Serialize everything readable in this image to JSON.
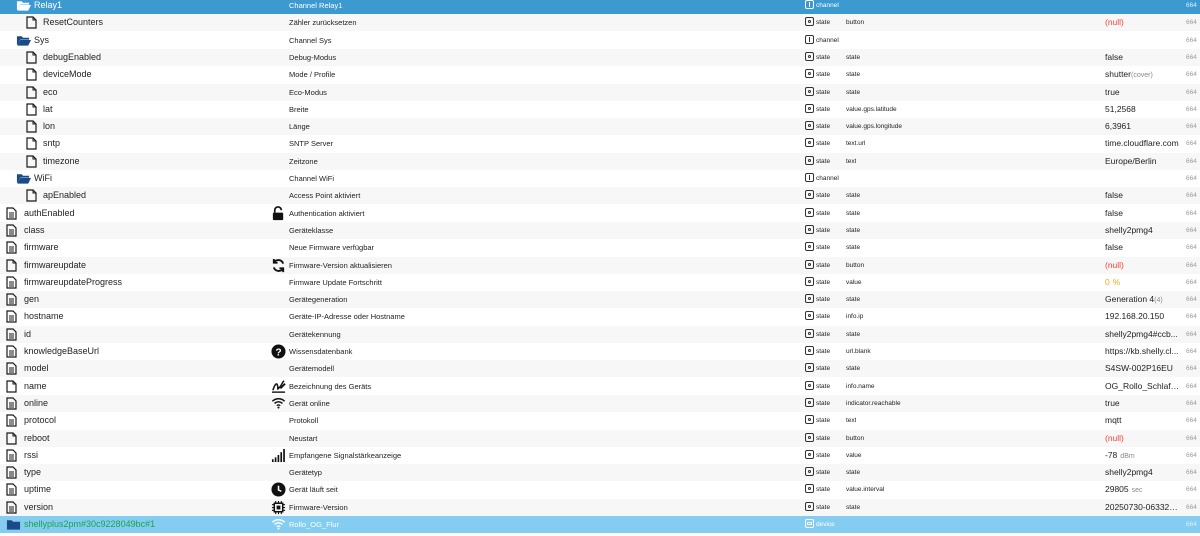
{
  "rows": [
    {
      "name": "Relay1",
      "desc": "Channel Relay1",
      "typeLabel": "channel",
      "role": "",
      "value": "",
      "num": "664",
      "icon": "folder-open",
      "indent": 1,
      "selected": true
    },
    {
      "name": "ResetCounters",
      "desc": "Zähler zurücksetzen",
      "typeLabel": "state",
      "role": "button",
      "value": "(null)",
      "num": "664",
      "icon": "file",
      "indent": 2
    },
    {
      "name": "Sys",
      "desc": "Channel Sys",
      "typeLabel": "channel",
      "role": "",
      "value": "",
      "num": "664",
      "icon": "folder-open",
      "indent": 1
    },
    {
      "name": "debugEnabled",
      "desc": "Debug-Modus",
      "typeLabel": "state",
      "role": "state",
      "value": "false",
      "num": "664",
      "icon": "file",
      "indent": 2
    },
    {
      "name": "deviceMode",
      "desc": "Mode / Profile",
      "typeLabel": "state",
      "role": "state",
      "value": "shutter",
      "valueExtra": "(cover)",
      "num": "664",
      "icon": "file",
      "indent": 2
    },
    {
      "name": "eco",
      "desc": "Eco-Modus",
      "typeLabel": "state",
      "role": "state",
      "value": "true",
      "num": "664",
      "icon": "file",
      "indent": 2
    },
    {
      "name": "lat",
      "desc": "Breite",
      "typeLabel": "state",
      "role": "value.gps.latitude",
      "value": "51,2568",
      "num": "664",
      "icon": "file",
      "indent": 2
    },
    {
      "name": "lon",
      "desc": "Länge",
      "typeLabel": "state",
      "role": "value.gps.longitude",
      "value": "6,3961",
      "num": "664",
      "icon": "file",
      "indent": 2
    },
    {
      "name": "sntp",
      "desc": "SNTP Server",
      "typeLabel": "state",
      "role": "text.url",
      "value": "time.cloudflare.com",
      "num": "664",
      "icon": "file",
      "indent": 2
    },
    {
      "name": "timezone",
      "desc": "Zeitzone",
      "typeLabel": "state",
      "role": "text",
      "value": "Europe/Berlin",
      "num": "664",
      "icon": "file",
      "indent": 2
    },
    {
      "name": "WiFi",
      "desc": "Channel WiFi",
      "typeLabel": "channel",
      "role": "",
      "value": "",
      "num": "664",
      "icon": "folder-open",
      "indent": 1
    },
    {
      "name": "apEnabled",
      "desc": "Access Point aktiviert",
      "typeLabel": "state",
      "role": "state",
      "value": "false",
      "num": "664",
      "icon": "file",
      "indent": 2
    },
    {
      "name": "authEnabled",
      "desc": "Authentication aktiviert",
      "descIcon": "lock-open",
      "typeLabel": "state",
      "role": "state",
      "value": "false",
      "num": "664",
      "icon": "file-lines",
      "indent": 0
    },
    {
      "name": "class",
      "desc": "Geräteklasse",
      "typeLabel": "state",
      "role": "state",
      "value": "shelly2pmg4",
      "num": "664",
      "icon": "file-lines",
      "indent": 0
    },
    {
      "name": "firmware",
      "desc": "Neue Firmware verfügbar",
      "typeLabel": "state",
      "role": "state",
      "value": "false",
      "num": "664",
      "icon": "file-lines",
      "indent": 0
    },
    {
      "name": "firmwareupdate",
      "desc": "Firmware-Version aktualisieren",
      "descIcon": "refresh",
      "typeLabel": "state",
      "role": "button",
      "value": "(null)",
      "num": "664",
      "icon": "file",
      "indent": 0
    },
    {
      "name": "firmwareupdateProgress",
      "desc": "Firmware Update Fortschritt",
      "typeLabel": "state",
      "role": "value",
      "value": "0",
      "valueExtra": "%",
      "num": "664",
      "icon": "file-lines",
      "indent": 0
    },
    {
      "name": "gen",
      "desc": "Gerätegeneration",
      "typeLabel": "state",
      "role": "state",
      "value": "Generation 4",
      "valueExtra": "(4)",
      "num": "664",
      "icon": "file-lines",
      "indent": 0
    },
    {
      "name": "hostname",
      "desc": "Geräte-IP-Adresse oder Hostname",
      "typeLabel": "state",
      "role": "info.ip",
      "value": "192.168.20.150",
      "num": "664",
      "icon": "file-lines",
      "indent": 0
    },
    {
      "name": "id",
      "desc": "Gerätekennung",
      "typeLabel": "state",
      "role": "state",
      "value": "shelly2pmg4#ccb...",
      "num": "664",
      "icon": "file-lines",
      "indent": 0
    },
    {
      "name": "knowledgeBaseUrl",
      "desc": "Wissensdatenbank",
      "descIcon": "question",
      "typeLabel": "state",
      "role": "url.blank",
      "value": "https://kb.shelly.cl...",
      "num": "664",
      "icon": "file-lines",
      "indent": 0
    },
    {
      "name": "model",
      "desc": "Gerätemodell",
      "typeLabel": "state",
      "role": "state",
      "value": "S4SW-002P16EU",
      "num": "664",
      "icon": "file-lines",
      "indent": 0
    },
    {
      "name": "name",
      "desc": "Bezeichnung des Geräts",
      "descIcon": "signature",
      "typeLabel": "state",
      "role": "info.name",
      "value": "OG_Rollo_Schlafzi...",
      "num": "664",
      "icon": "file",
      "indent": 0
    },
    {
      "name": "online",
      "desc": "Gerät online",
      "descIcon": "wifi",
      "typeLabel": "state",
      "role": "indicator.reachable",
      "value": "true",
      "num": "664",
      "icon": "file-lines",
      "indent": 0
    },
    {
      "name": "protocol",
      "desc": "Protokoll",
      "typeLabel": "state",
      "role": "text",
      "value": "mqtt",
      "num": "664",
      "icon": "file-lines",
      "indent": 0
    },
    {
      "name": "reboot",
      "desc": "Neustart",
      "typeLabel": "state",
      "role": "button",
      "value": "(null)",
      "num": "664",
      "icon": "file",
      "indent": 0
    },
    {
      "name": "rssi",
      "desc": "Empfangene Signalstärkeanzeige",
      "descIcon": "signal",
      "typeLabel": "state",
      "role": "value",
      "value": "-78",
      "valueExtra": "dBm",
      "num": "664",
      "icon": "file-lines",
      "indent": 0
    },
    {
      "name": "type",
      "desc": "Gerätetyp",
      "typeLabel": "state",
      "role": "state",
      "value": "shelly2pmg4",
      "num": "664",
      "icon": "file-lines",
      "indent": 0
    },
    {
      "name": "uptime",
      "desc": "Gerät läuft seit",
      "descIcon": "clock",
      "typeLabel": "state",
      "role": "value.interval",
      "value": "29805",
      "valueExtra": "sec",
      "num": "664",
      "icon": "file-lines",
      "indent": 0
    },
    {
      "name": "version",
      "desc": "Firmware-Version",
      "descIcon": "chip",
      "typeLabel": "state",
      "role": "state",
      "value": "20250730-063320...",
      "num": "664",
      "icon": "file-lines",
      "indent": 0
    },
    {
      "name": "shellyplus2pm#30c9228049bc#1",
      "desc": "Rollo_OG_Flur",
      "descIcon": "wifi",
      "typeLabel": "device",
      "role": "",
      "value": "",
      "num": "664",
      "icon": "folder",
      "indent": 0,
      "selected2": true
    }
  ],
  "colors": {
    "selected": "#3d9ad1",
    "selected2": "#84cdf0",
    "null": "#f44336",
    "percent": "#f5a623",
    "folder": "#1a4a8a"
  }
}
